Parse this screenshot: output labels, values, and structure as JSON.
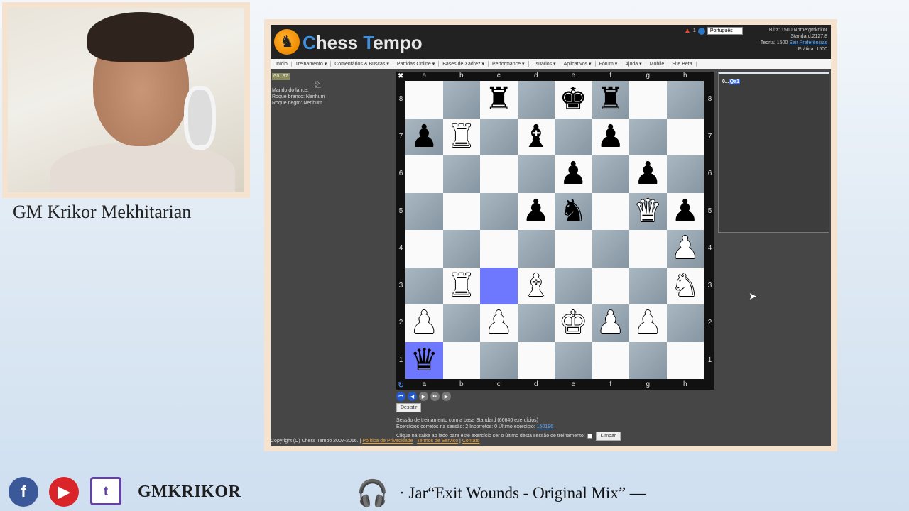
{
  "presenter": {
    "name": "GM Krikor Mekhitarian"
  },
  "site": {
    "logo_icon": "♞",
    "logo_c": "C",
    "logo_hess": "hess ",
    "logo_t": "T",
    "logo_empo": "empo",
    "top_right": {
      "fire_count": "1",
      "language": "Português",
      "blitz": "Blitz:  1500",
      "nome": "Nome:gmkrikor",
      "standard": "Standard:2127.8",
      "teoria": "Teoria:  1500",
      "sair": "Sair",
      "preferencias": "Preferências",
      "pratica": "Prática:  1500"
    },
    "menu": [
      "Início",
      "Treinamento ▾",
      "Comentários & Buscas ▾",
      "Partidas Online ▾",
      "Bases de Xadrez ▾",
      "Performance ▾",
      "Usuários ▾",
      "Aplicativos ▾",
      "Fórum ▾",
      "Ajuda ▾",
      "Mobile",
      "Site Beta"
    ],
    "timer": "00:37",
    "mando": "Mando do lance:",
    "roque_branco": "Roque branco: Nenhum",
    "roque_negro": "Roque negro: Nenhum",
    "moves": {
      "prefix": "0...",
      "current": "Qa1"
    },
    "desistir": "Desistir",
    "session_line1": "Sessão de treinamento com a base Standard (66640 exercícios)",
    "session_line2": "Exercícios corretos na sessão: 2  Incorretos: 0   Último exercício:",
    "session_last": "150196",
    "session_check": "Clique na caixa ao lado para este exercício ser o último desta sessão de treinamento:",
    "limpar": "Limpar",
    "copyright": "Copyright (C) Chess Tempo 2007-2016. |",
    "footer_links": [
      "Política de Privacidade",
      "Termos de Serviço",
      "Contato"
    ]
  },
  "board": {
    "files": [
      "a",
      "b",
      "c",
      "d",
      "e",
      "f",
      "g",
      "h"
    ],
    "ranks": [
      "8",
      "7",
      "6",
      "5",
      "4",
      "3",
      "2",
      "1"
    ],
    "pieces": {
      "c8": "r",
      "e8": "k",
      "f8": "r",
      "a7": "p",
      "b7": "R",
      "d7": "b",
      "f7": "p",
      "e6": "p",
      "g6": "p",
      "d5": "p",
      "e5": "n",
      "g5": "Q",
      "h5": "p",
      "h4": "P",
      "b3": "R",
      "d3": "B",
      "h3": "N",
      "a2": "P",
      "c2": "P",
      "e2": "K",
      "f2": "P",
      "g2": "P",
      "a1": "q"
    },
    "highlight": [
      "c3",
      "a1"
    ]
  },
  "bottom": {
    "facebook": "f",
    "youtube": "▶",
    "twitch": "t",
    "handle": "GMKRIKOR",
    "now_playing": "· Jar“Exit Wounds - Original Mix” —"
  }
}
